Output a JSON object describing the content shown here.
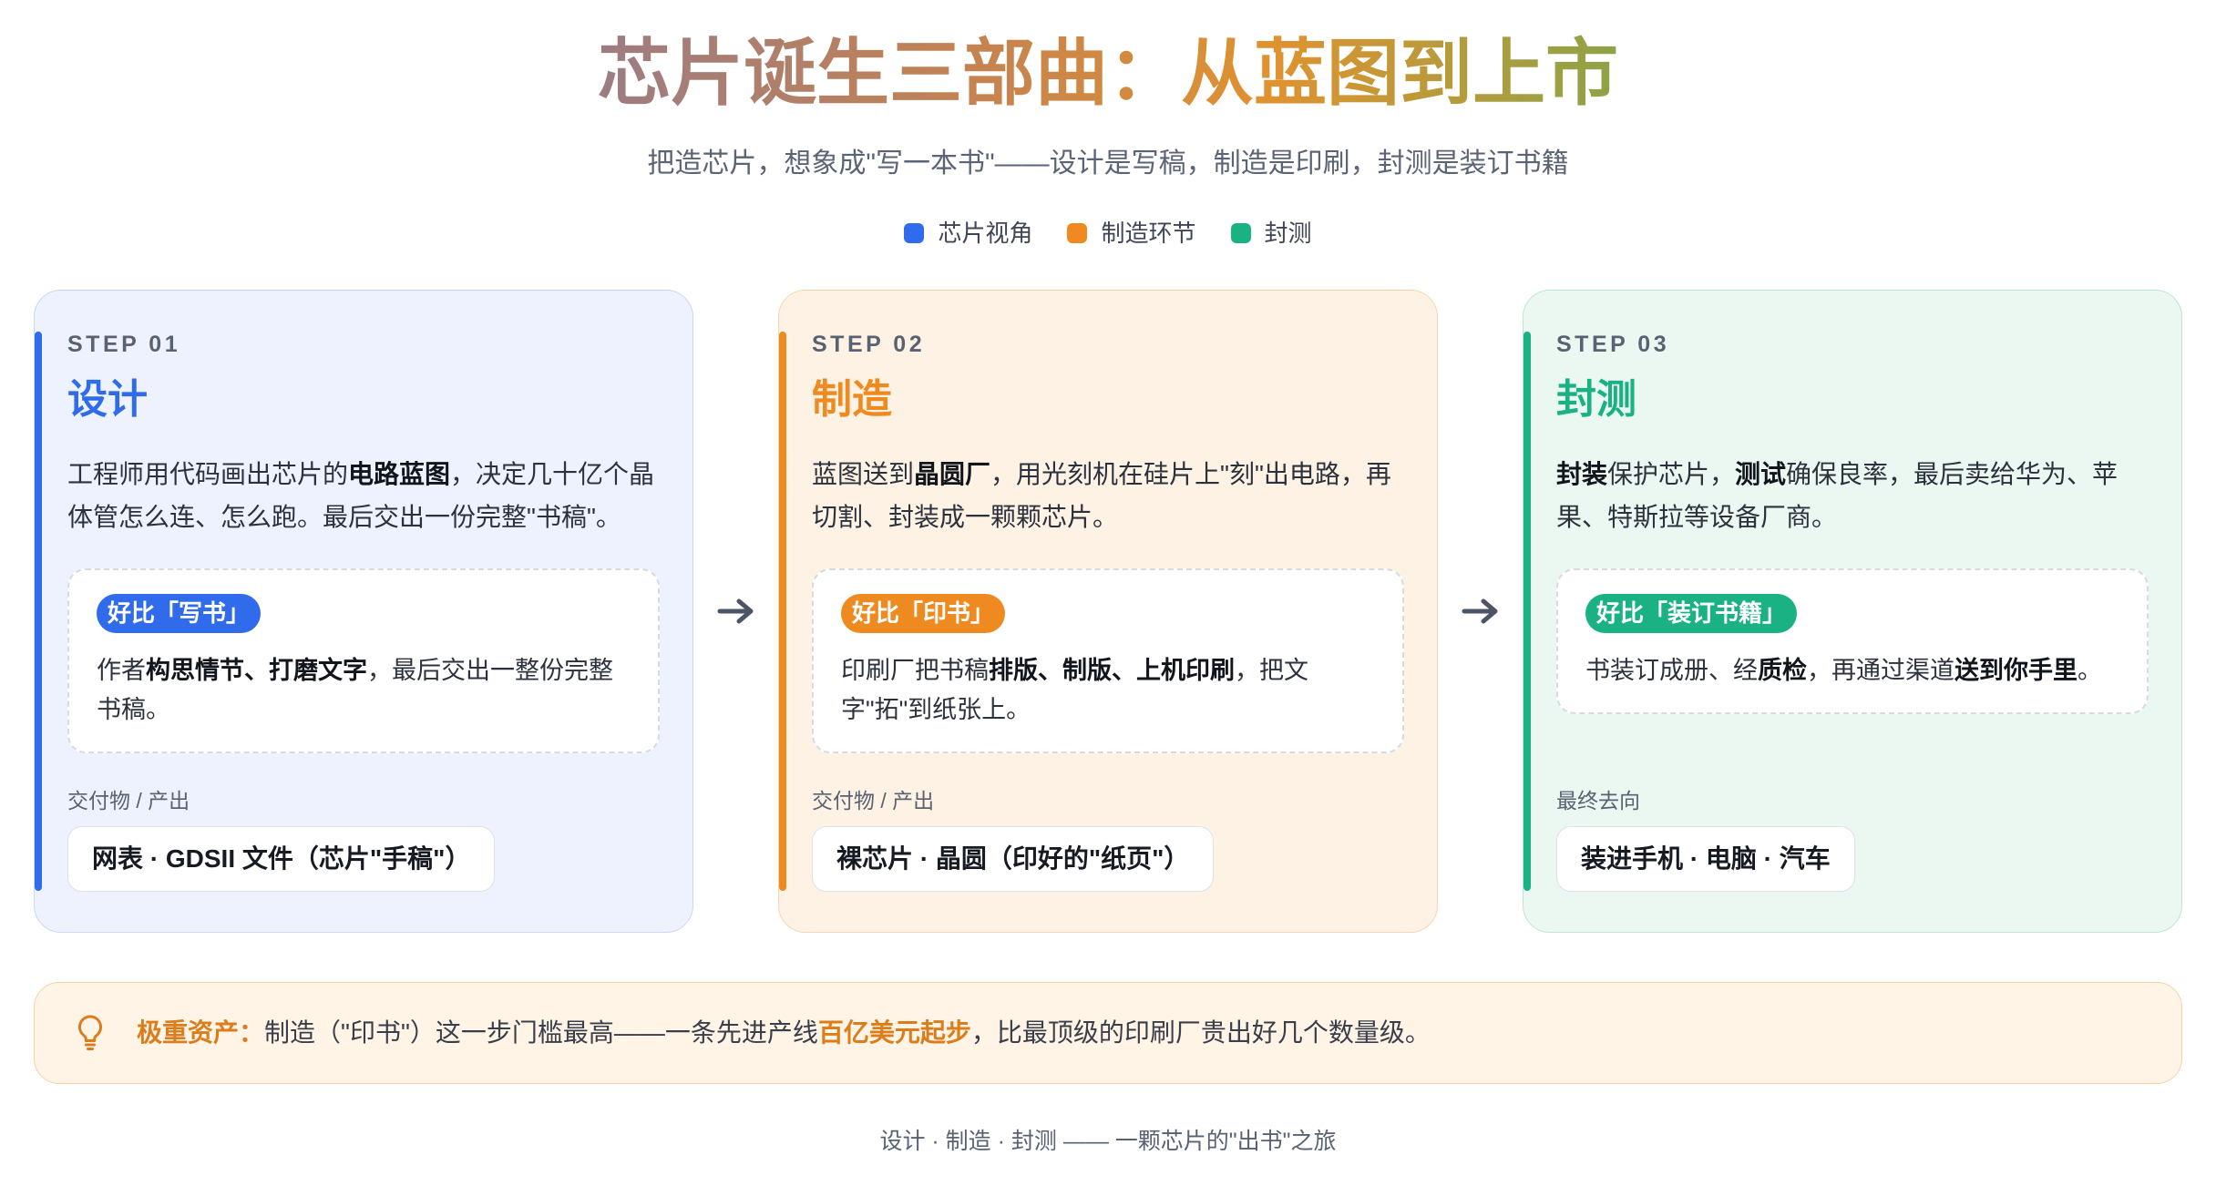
{
  "header": {
    "title": "芯片诞生三部曲：从蓝图到上市",
    "subtitle": "把造芯片，想象成\"写一本书\"——设计是写稿，制造是印刷，封测是装订书籍"
  },
  "legend": [
    {
      "label": "芯片视角",
      "color": "#2f6bea"
    },
    {
      "label": "制造环节",
      "color": "#ee8a1f"
    },
    {
      "label": "封测",
      "color": "#1bb283"
    }
  ],
  "theme": {
    "title_gradient": [
      "#9c7c82",
      "#c6834f",
      "#e0922f",
      "#8ea347"
    ],
    "callout_accent": "#dc7d1c",
    "callout_bg": "#fff4e6",
    "callout_border": "#f6d3a4",
    "arrow_color": "#4d5466"
  },
  "steps": [
    {
      "step_label": "STEP 01",
      "name": "设计",
      "accent": "#2f6bea",
      "card_bg": "#edf2fe",
      "card_border": "#cad6f4",
      "description": [
        "工程师用代码画出芯片的",
        "电路蓝图",
        "，决定几十亿个晶体管怎么连、怎么跑。最后交出一份完整\"书稿\"。"
      ],
      "analogy": {
        "tag": "好比「写书」",
        "text": [
          "作者",
          "构思情节、打磨文字",
          "，最后交出一整份完整书稿。"
        ]
      },
      "output": {
        "label": "交付物 / 产出",
        "value": "网表 · GDSII 文件（芯片\"手稿\"）"
      }
    },
    {
      "step_label": "STEP 02",
      "name": "制造",
      "accent": "#ee8a1f",
      "card_bg": "#fef2e5",
      "card_border": "#f4d6b5",
      "description": [
        "蓝图送到",
        "晶圆厂",
        "，用光刻机在硅片上\"刻\"出电路，再切割、封装成一颗颗芯片。"
      ],
      "analogy": {
        "tag": "好比「印书」",
        "text": [
          "印刷厂把书稿",
          "排版、制版、上机印刷",
          "，把文字\"拓\"到纸张上。"
        ]
      },
      "output": {
        "label": "交付物 / 产出",
        "value": "裸芯片 · 晶圆（印好的\"纸页\"）"
      }
    },
    {
      "step_label": "STEP 03",
      "name": "封测",
      "accent": "#1bb283",
      "card_bg": "#eaf8f1",
      "card_border": "#bde6d3",
      "description": [
        "封装",
        "保护芯片，",
        "测试",
        "确保良率，最后卖给华为、苹果、特斯拉等设备厂商。"
      ],
      "analogy": {
        "tag": "好比「装订书籍」",
        "text": [
          "书装订成册、经",
          "质检",
          "，再通过渠道",
          "送到你手里",
          "。"
        ]
      },
      "output": {
        "label": "最终去向",
        "value": "装进手机 · 电脑 · 汽车"
      }
    }
  ],
  "flow_arrows": [
    "arrow-right-icon",
    "arrow-right-icon"
  ],
  "callout": {
    "icon": "lightbulb-icon",
    "label": "极重资产：",
    "text": [
      "制造（\"印书\"）这一步门槛最高——一条先进产线",
      "百亿美元起步",
      "，比最顶级的印刷厂贵出好几个数量级。"
    ]
  },
  "footer": "设计 · 制造 · 封测 —— 一颗芯片的\"出书\"之旅"
}
